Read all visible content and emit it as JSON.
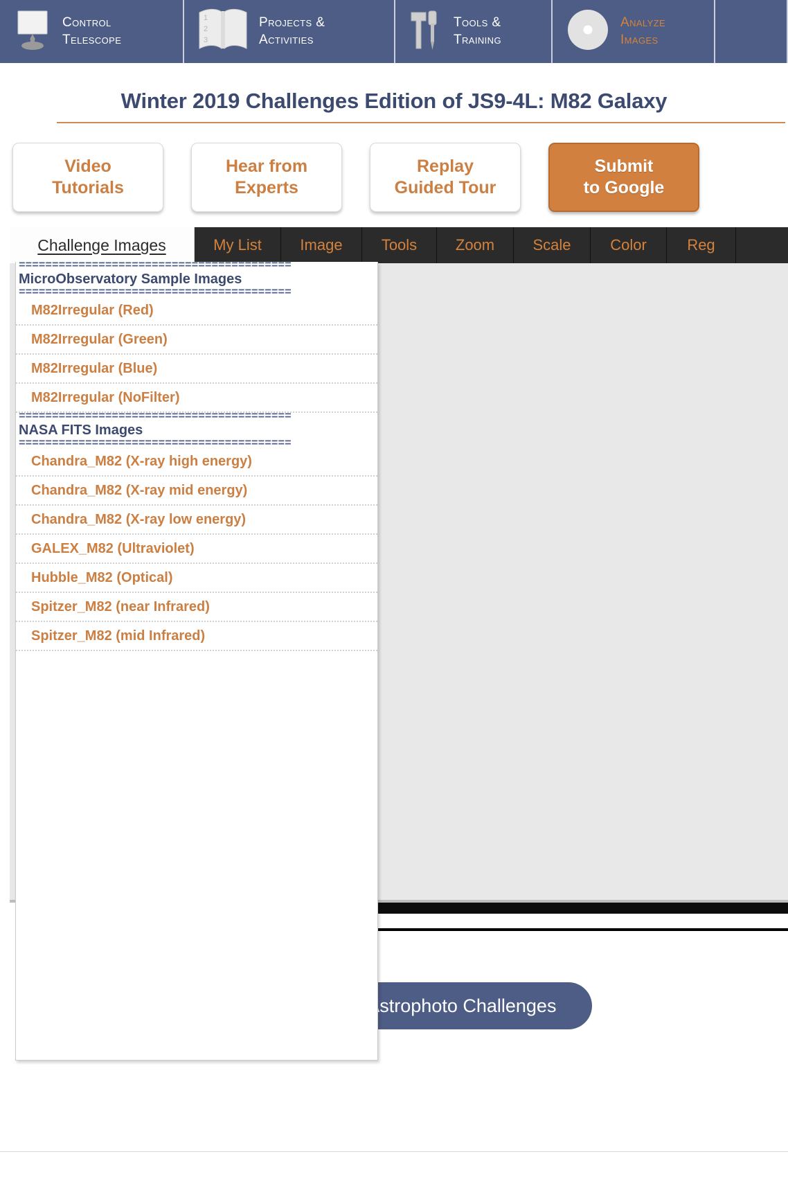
{
  "topnav": {
    "items": [
      {
        "label": "Control\nTelescope",
        "icon": "monitor-telescope-icon",
        "active": false
      },
      {
        "label": "Projects &\nActivities",
        "icon": "open-book-icon",
        "active": false
      },
      {
        "label": "Tools &\nTraining",
        "icon": "hammer-screwdriver-icon",
        "active": false
      },
      {
        "label": "Analyze\nImages",
        "icon": "cd-disc-icon",
        "active": true
      }
    ],
    "colors": {
      "background": "#4e5d86",
      "text": "#ffffff",
      "active_text": "#d4823c",
      "divider": "#c9cfdf"
    }
  },
  "header": {
    "title": "Winter 2019 Challenges Edition of JS9-4L: M82 Galaxy",
    "title_color": "#3c4a70",
    "rule_color": "#cf8a4f"
  },
  "actions": {
    "buttons": [
      {
        "label": "Video\nTutorials",
        "style": "light"
      },
      {
        "label": "Hear from\nExperts",
        "style": "light"
      },
      {
        "label": "Replay\nGuided Tour",
        "style": "light"
      },
      {
        "label": "Submit\nto Google",
        "style": "solid"
      }
    ],
    "light_text_color": "#cb7f42",
    "solid_background": "#d1803f"
  },
  "menubar": {
    "tabs": [
      {
        "label": "Challenge Images",
        "active": true
      },
      {
        "label": "My List",
        "active": false
      },
      {
        "label": "Image",
        "active": false
      },
      {
        "label": "Tools",
        "active": false
      },
      {
        "label": "Zoom",
        "active": false
      },
      {
        "label": "Scale",
        "active": false
      },
      {
        "label": "Color",
        "active": false
      },
      {
        "label": "Reg",
        "active": false
      }
    ],
    "background": "#2b2b2b",
    "text_color": "#d4823c",
    "active_background": "#fdfdfd",
    "active_text_color": "#2b2b2b"
  },
  "dropdown": {
    "separator": "=========================================",
    "groups": [
      {
        "heading": "MicroObservatory Sample Images",
        "items": [
          "M82Irregular (Red)",
          "M82Irregular (Green)",
          "M82Irregular (Blue)",
          "M82Irregular (NoFilter)"
        ]
      },
      {
        "heading": "NASA FITS Images",
        "items": [
          "Chandra_M82 (X-ray high energy)",
          "Chandra_M82 (X-ray mid energy)",
          "Chandra_M82 (X-ray low energy)",
          "GALEX_M82 (Ultraviolet)",
          "Hubble_M82 (Optical)",
          "Spitzer_M82 (near Infrared)",
          "Spitzer_M82 (mid Infrared)"
        ]
      }
    ],
    "heading_color": "#3c4a70",
    "item_color": "#cb7f42"
  },
  "footer": {
    "back_button": "Back to NASA's Astrophoto Challenges",
    "back_button_color": "#4e5d86"
  }
}
